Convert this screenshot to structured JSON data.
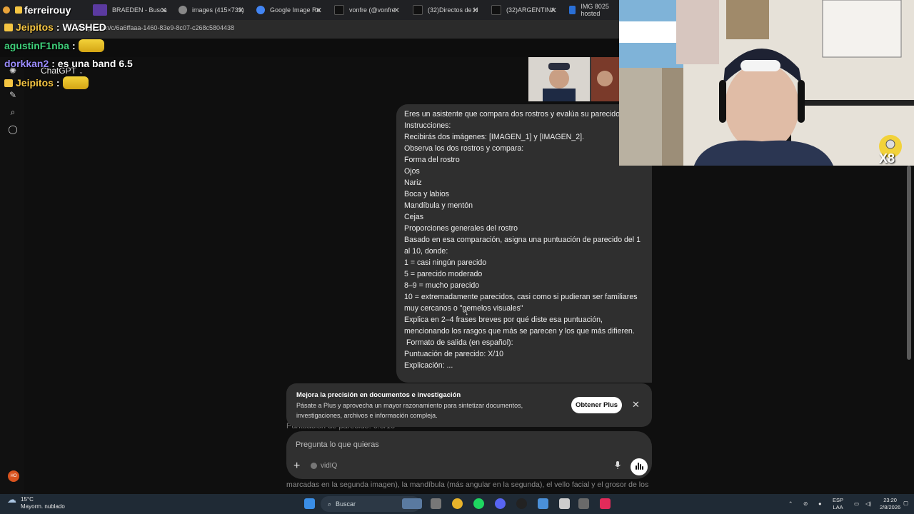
{
  "browser": {
    "tabs": [
      {
        "label": "ferreirouy",
        "color": "#3a3a3a"
      },
      {
        "label": "BRAEDEN - Busca",
        "color": "#5b3aa0"
      },
      {
        "label": "images (415×739)",
        "color": "#888888"
      },
      {
        "label": "Google Image Re",
        "color": "#4285f4"
      },
      {
        "label": "vonfre (@vonfre",
        "color": "#111111"
      },
      {
        "label": "(32)Directos de H",
        "color": "#111111"
      },
      {
        "label": "(32)ARGENTINA",
        "color": "#111111"
      },
      {
        "label": "IMG 8025 hosted",
        "color": "#2a6fd6"
      }
    ],
    "url": "chatgpt.com/c/6a6ffaaa-1460-83e9-8c07-c268c5804438"
  },
  "stream_chat": [
    {
      "user": "Jeipitos",
      "text": ": WASHED",
      "color": "#f5c542",
      "emote": false
    },
    {
      "user": "agustinF1nba",
      "text": ":",
      "color": "#3fd07a",
      "emote": true
    },
    {
      "user": "dorkkan2",
      "text": ": es una band 6.5",
      "color": "#9b8cff",
      "emote": false
    },
    {
      "user": "Jeipitos",
      "text": ":",
      "color": "#f5c542",
      "emote": true
    }
  ],
  "app": {
    "title": "ChatGPT",
    "message_lines": [
      "Eres un asistente que compara dos rostros y evalúa su parecido v",
      "Instrucciones:",
      "Recibirás dos imágenes: [IMAGEN_1] y [IMAGEN_2].",
      "Observa los dos rostros y compara:",
      "Forma del rostro",
      "Ojos",
      "Nariz",
      "Boca y labios",
      "Mandíbula y mentón",
      "Cejas",
      "Proporciones generales del rostro",
      "Basado en esa comparación, asigna una puntuación de parecido del 1",
      "al 10, donde:",
      "1 = casi ningún parecido",
      "5 = parecido moderado",
      "8–9 = mucho parecido",
      "10 = extremadamente parecidos, casi como si pudieran ser familiares",
      "muy cercanos o \"gemelos visuales\"",
      "Explica en 2–4 frases breves por qué diste esa puntuación,",
      "mencionando los rasgos que más se parecen y los que más difieren.",
      " Formato de salida (en español):",
      "Puntuación de parecido: X/10",
      "Explicación: ..."
    ],
    "behind_text": "Puntuación de parecido: 6.5/10",
    "banner": {
      "title": "Mejora la precisión en documentos e investigación",
      "body": "Pásate a Plus y aprovecha un mayor razonamiento para sintetizar documentos, investigaciones, archivos e información compleja.",
      "cta": "Obtener Plus"
    },
    "composer": {
      "placeholder": "Pregunta lo que quieras",
      "tool_label": "vidIQ"
    },
    "bottom_text": "marcadas en la segunda imagen), la mandíbula (más angular en la segunda), el vello facial y el grosor de los",
    "avatar_initials": "HO"
  },
  "overlay": {
    "multiplier": "X8"
  },
  "taskbar": {
    "weather_temp": "15°C",
    "weather_desc": "Mayorm. nublado",
    "search_label": "Buscar",
    "lang": "ESP",
    "lang_sub": "LAA",
    "time": "23:20",
    "date": "2/8/2026"
  }
}
